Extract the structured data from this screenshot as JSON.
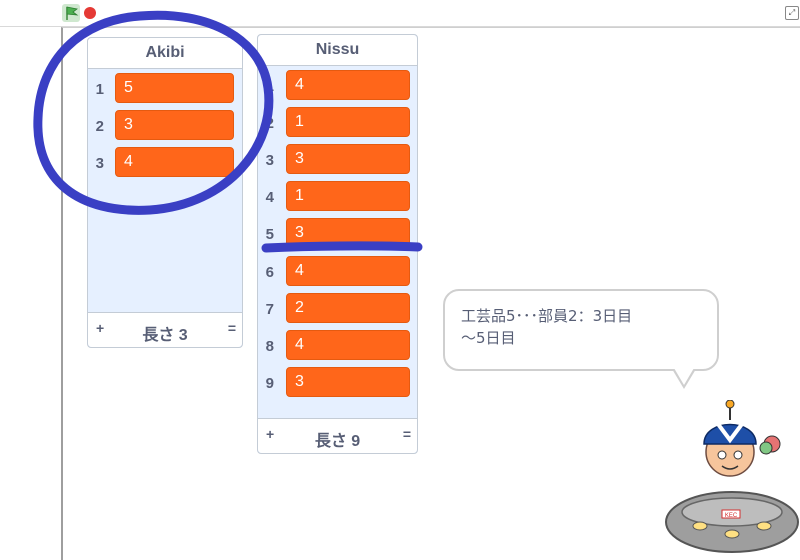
{
  "lists": [
    {
      "name": "Akibi",
      "items": [
        "5",
        "3",
        "4"
      ],
      "length_label": "長さ 3"
    },
    {
      "name": "Nissu",
      "items": [
        "4",
        "1",
        "3",
        "1",
        "3",
        "4",
        "2",
        "4",
        "3"
      ],
      "length_label": "長さ 9"
    }
  ],
  "list_footer": {
    "plus": "+",
    "equals": "="
  },
  "speech_bubble": {
    "text_line1": "工芸品5･･･部員2：3日目",
    "text_line2": "～5日目"
  },
  "sprite": {
    "badge": "KEC"
  },
  "window_controls": {
    "fullscreen": "⤢"
  },
  "colors": {
    "cell": "#ff661a",
    "annotation": "#3a3fc4",
    "monitor_bg": "#e6f0ff"
  }
}
